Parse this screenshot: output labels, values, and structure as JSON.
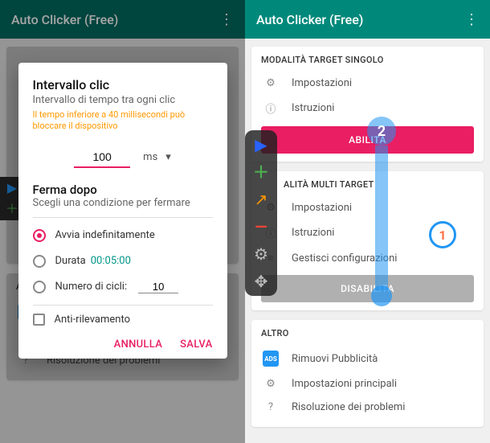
{
  "app": {
    "title": "Auto Clicker (Free)"
  },
  "dialog": {
    "title": "Intervallo clic",
    "subtitle": "Intervallo di tempo tra ogni clic",
    "warning": "Il tempo inferiore a 40 millisecondi può bloccare il dispositivo",
    "interval_value": "100",
    "unit": "ms",
    "stop_title": "Ferma dopo",
    "stop_subtitle": "Scegli una condizione per fermare",
    "opt_infinite": "Avvia indefinitamente",
    "opt_duration": "Durata",
    "duration_value": "00:05:00",
    "opt_cycles": "Numero di cicli:",
    "cycles_value": "10",
    "anti_detect": "Anti-rilevamento",
    "cancel": "ANNULLA",
    "save": "SALVA"
  },
  "sections": {
    "single": "MODALITÀ TARGET SINGOLO",
    "multi": "ALITÀ MULTI TARGET",
    "multi_full": "MODALITÀ MULTI TARGET",
    "other": "ALTRO"
  },
  "rows": {
    "settings": "Impostazioni",
    "instructions": "Istruzioni",
    "manage": "Gestisci configurazioni",
    "remove_ads_left": "Rimuovi Pubblicità",
    "remove_ads": "Rimuovi Pubblicità",
    "main_settings": "Impostazioni principali",
    "troubleshoot": "Risoluzione dei problemi"
  },
  "buttons": {
    "enable": "ABILITA",
    "disable": "DISABILITA"
  },
  "left_other_title": "A",
  "markers": {
    "one": "1",
    "two": "2"
  },
  "ads_badge": "ADS"
}
